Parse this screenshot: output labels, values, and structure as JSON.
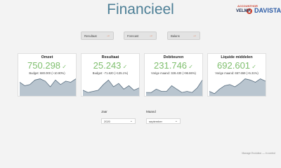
{
  "header": {
    "title": "Financieel",
    "logo": {
      "top_text": "ACCOUNTHOR",
      "left_text": "VELMA",
      "right_text": "DAVISTA"
    }
  },
  "nav": [
    {
      "label": "Resultaat",
      "icon": "arrow-right-icon"
    },
    {
      "label": "Forecast",
      "icon": "arrow-right-icon"
    },
    {
      "label": "Balans",
      "icon": "arrow-right-icon"
    }
  ],
  "cards": [
    {
      "title": "Omzet",
      "value": "750.298",
      "sub": "Budget: 680.000 (+10.90%)",
      "spark": [
        12,
        9,
        10,
        14,
        15,
        13,
        8,
        14,
        10,
        13,
        12,
        15
      ]
    },
    {
      "title": "Resultaat",
      "value": "25.243",
      "sub": "Budget: -71.620 (+135.1%)",
      "spark": [
        5,
        3,
        4,
        5,
        10,
        14,
        8,
        11,
        6,
        9,
        5,
        7
      ]
    },
    {
      "title": "Debiteuren",
      "value": "231.746",
      "sub": "Vorige maand: 328.430 (+96.86%)",
      "spark": [
        3,
        3,
        6,
        4,
        4,
        9,
        6,
        3,
        4,
        3,
        7,
        14
      ]
    },
    {
      "title": "Liquide middelen",
      "value": "692.601",
      "sub": "Vorige maand: 657.659 (+5.31%)",
      "spark": [
        4,
        2,
        6,
        9,
        10,
        8,
        11,
        15,
        14,
        12,
        15,
        13
      ]
    }
  ],
  "filters": {
    "jaar": {
      "label": "Jaar",
      "value": "2020"
    },
    "maand": {
      "label": "Maand",
      "value": "september"
    }
  },
  "footer": "Manage Evolution — in control",
  "colors": {
    "title": "#4d7f96",
    "value": "#7fbf6e",
    "spark_fill": "#b9c5cf",
    "spark_line": "#5a6f80",
    "arrow": "#e26a3b"
  }
}
